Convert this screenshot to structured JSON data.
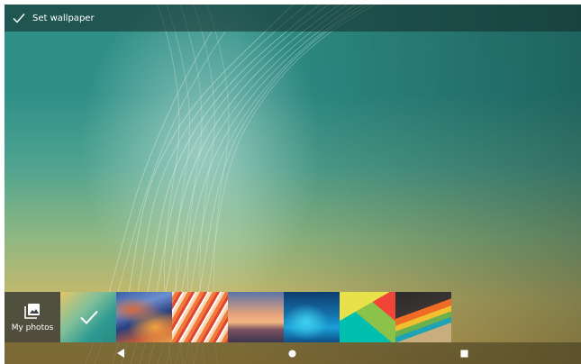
{
  "topbar": {
    "set_wallpaper_label": "Set wallpaper",
    "check_icon": "check-icon"
  },
  "picker": {
    "my_photos_label": "My photos",
    "my_photos_icon": "photo-library-icon",
    "selected_index": 0,
    "wallpapers": [
      {
        "name": "teal-waves",
        "selected": true
      },
      {
        "name": "marble-blue-orange",
        "selected": false
      },
      {
        "name": "orange-stripes",
        "selected": false
      },
      {
        "name": "sunset-mountains",
        "selected": false
      },
      {
        "name": "underwater-fish",
        "selected": false
      },
      {
        "name": "material-shapes",
        "selected": false
      },
      {
        "name": "rainbow-stripes",
        "selected": false
      }
    ]
  },
  "navbar": {
    "back_icon": "back-triangle-icon",
    "home_icon": "home-circle-icon",
    "recents_icon": "recents-square-icon"
  },
  "colors": {
    "topbar_bg": "#14282880",
    "accent_white": "#ffffff",
    "wallpaper_teal": "#2f8f86",
    "wallpaper_gold": "#caa550"
  }
}
